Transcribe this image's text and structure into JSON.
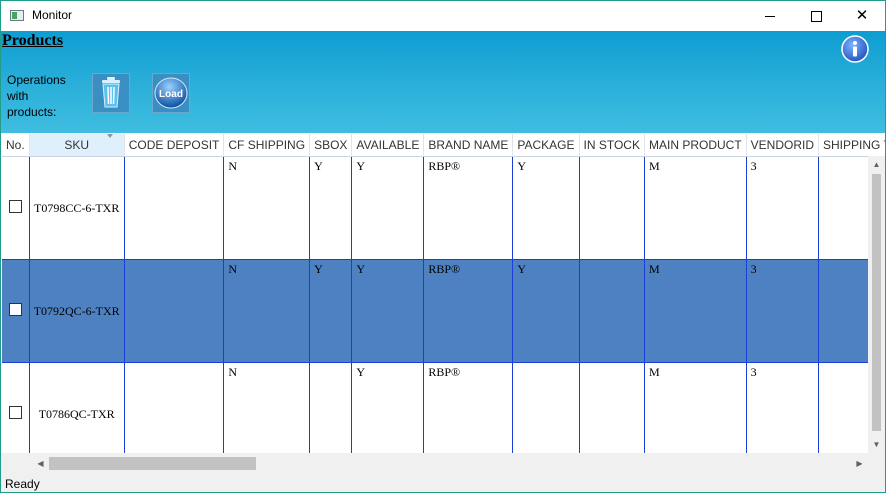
{
  "window": {
    "title": "Monitor"
  },
  "header": {
    "title": "Products",
    "operations_label": "Operations with products:",
    "load_label": "Load"
  },
  "grid": {
    "columns": [
      "No.",
      "SKU",
      "CODE DEPOSIT",
      "CF SHIPPING",
      "SBOX",
      "AVAILABLE",
      "BRAND NAME",
      "PACKAGE",
      "IN STOCK",
      "MAIN PRODUCT",
      "VENDORID",
      "SHIPPING TYPE"
    ],
    "rows": [
      {
        "sku": "T0798CC-6-TXR",
        "code_deposit": "",
        "cf_shipping": "N",
        "sbox": "Y",
        "available": "Y",
        "brand_name": "RBP®",
        "package": "Y",
        "in_stock": "",
        "main_product": "M",
        "vendorid": "3",
        "shipping_type": "",
        "selected": false
      },
      {
        "sku": "T0792QC-6-TXR",
        "code_deposit": "",
        "cf_shipping": "N",
        "sbox": "Y",
        "available": "Y",
        "brand_name": "RBP®",
        "package": "Y",
        "in_stock": "",
        "main_product": "M",
        "vendorid": "3",
        "shipping_type": "",
        "selected": true
      },
      {
        "sku": "T0786QC-TXR",
        "code_deposit": "",
        "cf_shipping": "N",
        "sbox": "",
        "available": "Y",
        "brand_name": "RBP®",
        "package": "",
        "in_stock": "",
        "main_product": "M",
        "vendorid": "3",
        "shipping_type": "",
        "selected": false
      }
    ]
  },
  "status": {
    "text": "Ready"
  },
  "colors": {
    "banner": "#0e9dd2",
    "selected_row": "#4d81c2",
    "cell_border": "#1a3fd6",
    "window_border": "#1f9c8a"
  },
  "icons": {
    "app": "window-app-icon",
    "info": "info-icon",
    "delete": "trash-can-icon",
    "load": "load-icon"
  }
}
